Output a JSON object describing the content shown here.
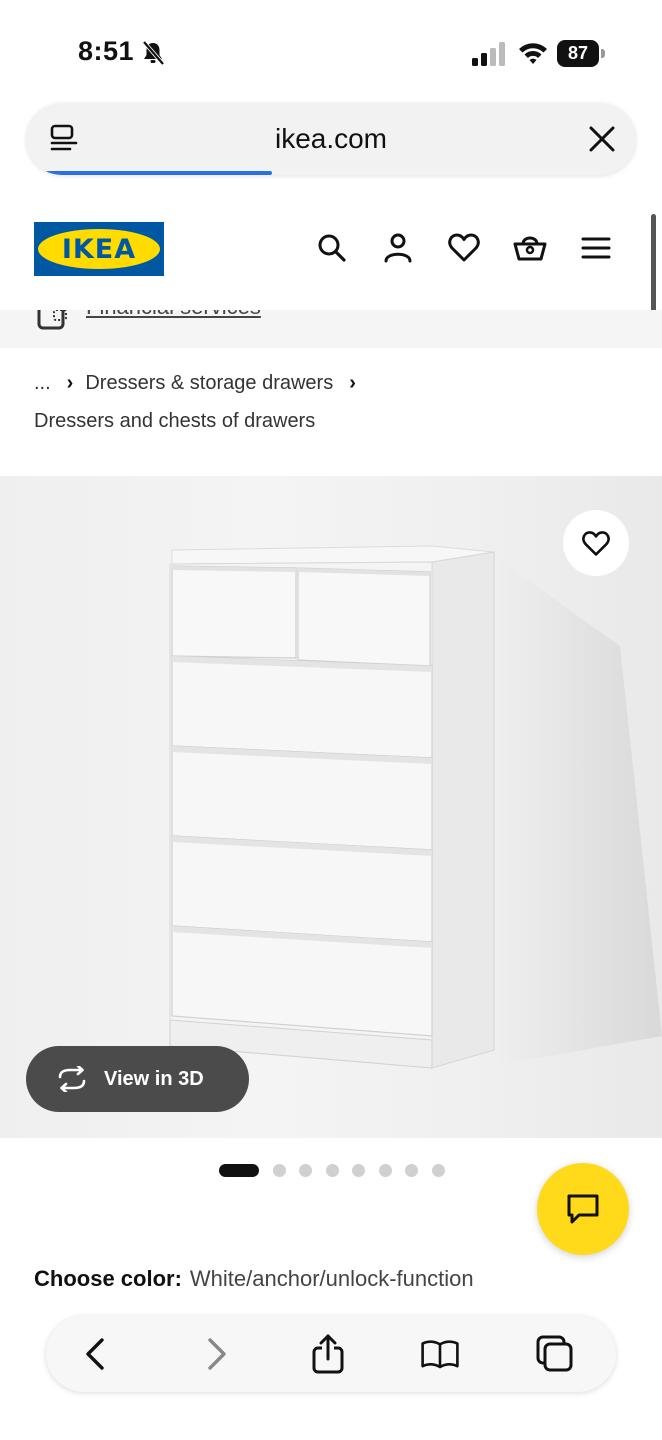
{
  "status_bar": {
    "time": "8:51",
    "battery": "87"
  },
  "browser": {
    "url": "ikea.com",
    "load_progress": 0.38
  },
  "header": {
    "logo_text": "IKEA",
    "icons": [
      "search-icon",
      "account-icon",
      "heart-icon",
      "basket-icon",
      "menu-icon"
    ]
  },
  "promo": {
    "financial_services": "Financial services"
  },
  "breadcrumb": {
    "ellipsis": "...",
    "level1": "Dressers & storage drawers",
    "current": "Dressers and chests of drawers"
  },
  "product": {
    "view_3d": "View in 3D",
    "carousel_total": 8,
    "carousel_active": 1,
    "choose_color_label": "Choose color:",
    "color_value": "White/anchor/unlock-function"
  },
  "colors": {
    "ikea_blue": "#0058a3",
    "ikea_yellow": "#ffdb00",
    "chat_yellow": "#ffda1a",
    "progress_blue": "#2b6fe4"
  },
  "toolbar": {
    "icons": [
      "back-icon",
      "forward-icon",
      "share-icon",
      "bookmarks-icon",
      "tabs-icon"
    ]
  }
}
